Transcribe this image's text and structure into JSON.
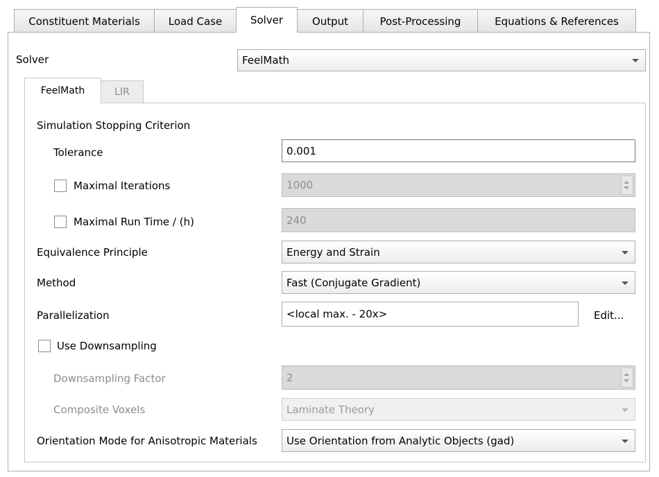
{
  "tabs": [
    {
      "label": "Constituent Materials",
      "active": false
    },
    {
      "label": "Load Case",
      "active": false
    },
    {
      "label": "Solver",
      "active": true
    },
    {
      "label": "Output",
      "active": false
    },
    {
      "label": "Post-Processing",
      "active": false
    },
    {
      "label": "Equations & References",
      "active": false
    }
  ],
  "solver": {
    "label": "Solver",
    "value": "FeelMath"
  },
  "subtabs": [
    {
      "label": "FeelMath",
      "active": true
    },
    {
      "label": "LIR",
      "active": false
    }
  ],
  "form": {
    "stopping_section": "Simulation Stopping Criterion",
    "tolerance": {
      "label": "Tolerance",
      "value": "0.001"
    },
    "max_iterations": {
      "label": "Maximal Iterations",
      "value": "1000",
      "checked": false
    },
    "max_run_time": {
      "label": "Maximal Run Time / (h)",
      "value": "240",
      "checked": false
    },
    "equivalence": {
      "label": "Equivalence Principle",
      "value": "Energy and Strain"
    },
    "method": {
      "label": "Method",
      "value": "Fast (Conjugate Gradient)"
    },
    "parallelization": {
      "label": "Parallelization",
      "value": "<local max. - 20x>",
      "edit_label": "Edit..."
    },
    "downsampling": {
      "label": "Use Downsampling",
      "checked": false
    },
    "downsampling_factor": {
      "label": "Downsampling Factor",
      "value": "2"
    },
    "composite_voxels": {
      "label": "Composite Voxels",
      "value": "Laminate Theory"
    },
    "orientation": {
      "label": "Orientation Mode for Anisotropic Materials",
      "value": "Use Orientation from Analytic Objects (gad)"
    }
  },
  "colors": {
    "border": "#adadad",
    "disabled_field": "#dadada",
    "dim_text": "#8c8c8c"
  }
}
